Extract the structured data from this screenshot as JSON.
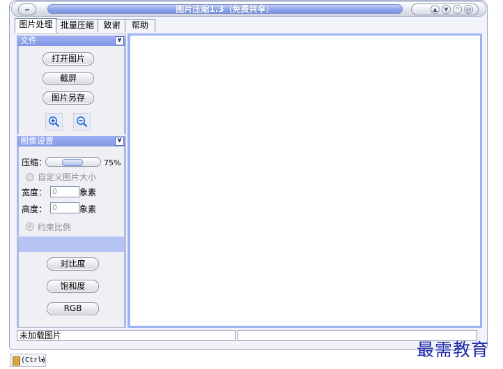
{
  "window": {
    "title": "图片压缩1.3（免费共享）",
    "controls": [
      "▲",
      "▼",
      "^",
      "@"
    ]
  },
  "tabs": [
    {
      "label": "图片处理",
      "active": true
    },
    {
      "label": "批量压缩",
      "active": false
    },
    {
      "label": "致谢",
      "active": false
    },
    {
      "label": "帮助",
      "active": false
    }
  ],
  "file_section": {
    "title": "文件",
    "open_label": "打开图片",
    "screenshot_label": "截屏",
    "save_as_label": "图片另存",
    "zoom_in_icon": "zoom-in-icon",
    "zoom_out_icon": "zoom-out-icon"
  },
  "image_settings": {
    "title": "图像设置",
    "compression_label": "压缩：",
    "compression_value": "75%",
    "compression_level": 0.75,
    "custom_size_label": "自定义图片大小",
    "width_label": "宽度：",
    "width_value": "0",
    "height_label": "高度：",
    "height_value": "0",
    "unit_label": "象素",
    "constrain_label": "约束比例"
  },
  "adjust": {
    "contrast_label": "对比度",
    "saturation_label": "饱和度",
    "rgb_label": "RGB"
  },
  "status": {
    "left": "未加载图片",
    "right": ""
  },
  "paste_chip": {
    "label": "(Ctrl)",
    "caret": "▾"
  },
  "watermark": "最需教育",
  "colors": {
    "accent": "#8398e6",
    "canvas_border": "#9fb3f4",
    "watermark": "#1f2aa8"
  }
}
